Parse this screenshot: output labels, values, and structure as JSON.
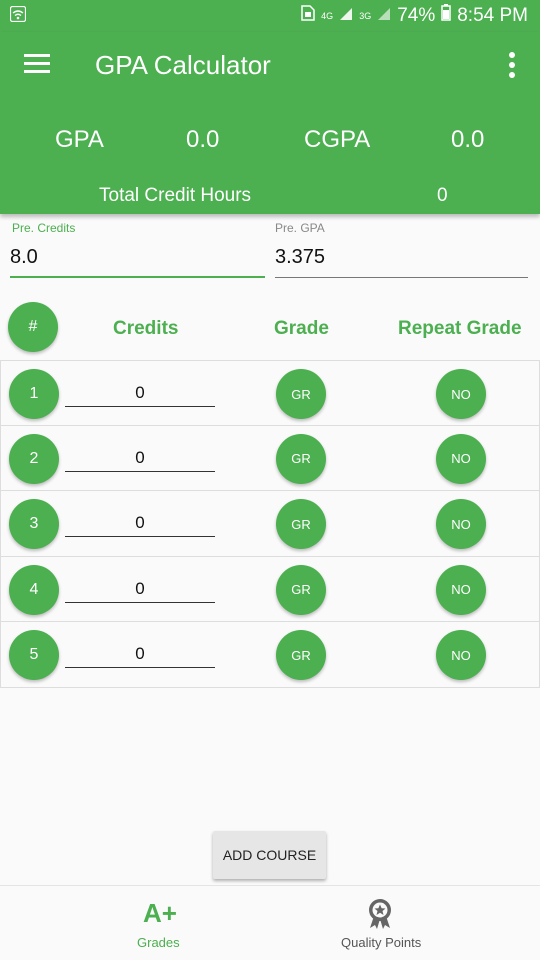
{
  "status_bar": {
    "network_4g": "4G",
    "network_3g": "3G",
    "battery": "74%",
    "time": "8:54 PM"
  },
  "app": {
    "title": "GPA Calculator"
  },
  "summary": {
    "gpa_label": "GPA",
    "gpa_value": "0.0",
    "cgpa_label": "CGPA",
    "cgpa_value": "0.0",
    "total_credit_hours_label": "Total Credit Hours",
    "total_credit_hours_value": "0"
  },
  "previous": {
    "credits_label": "Pre. Credits",
    "credits_value": "8.0",
    "gpa_label": "Pre. GPA",
    "gpa_value": "3.375"
  },
  "table_header": {
    "number": "#",
    "credits": "Credits",
    "grade": "Grade",
    "repeat_grade": "Repeat Grade"
  },
  "courses": [
    {
      "number": "1",
      "credits": "0",
      "grade": "GR",
      "repeat": "NO"
    },
    {
      "number": "2",
      "credits": "0",
      "grade": "GR",
      "repeat": "NO"
    },
    {
      "number": "3",
      "credits": "0",
      "grade": "GR",
      "repeat": "NO"
    },
    {
      "number": "4",
      "credits": "0",
      "grade": "GR",
      "repeat": "NO"
    },
    {
      "number": "5",
      "credits": "0",
      "grade": "GR",
      "repeat": "NO"
    }
  ],
  "add_course_label": "ADD COURSE",
  "bottom_nav": {
    "grades_icon_text": "A+",
    "grades_label": "Grades",
    "quality_points_label": "Quality Points"
  },
  "colors": {
    "primary": "#4caf50",
    "background": "#fafafa",
    "inactive_nav": "#555555"
  }
}
